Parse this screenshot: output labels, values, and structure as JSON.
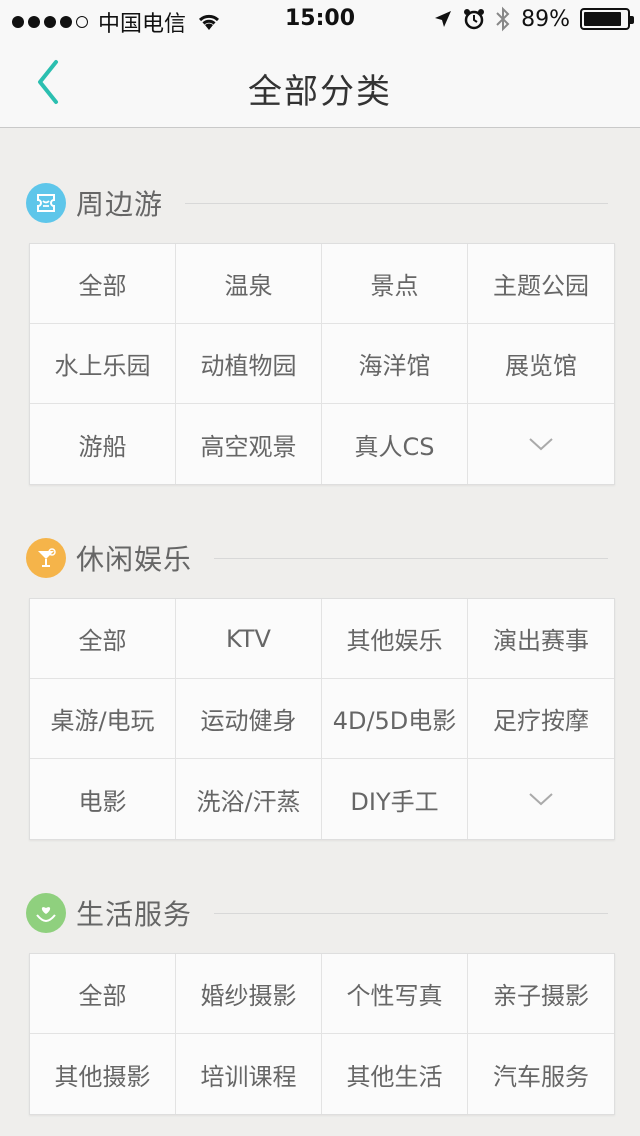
{
  "status_bar": {
    "carrier": "中国电信",
    "time": "15:00",
    "battery_text": "89%",
    "battery_level": 0.89
  },
  "nav": {
    "title": "全部分类",
    "accent_color": "#2bbfb0"
  },
  "sections": [
    {
      "title": "周边游",
      "icon": "ticket-icon",
      "icon_color": "#5ec6ea",
      "items": [
        "全部",
        "温泉",
        "景点",
        "主题公园",
        "水上乐园",
        "动植物园",
        "海洋馆",
        "展览馆",
        "游船",
        "高空观景",
        "真人CS"
      ],
      "has_expand": true
    },
    {
      "title": "休闲娱乐",
      "icon": "cocktail-icon",
      "icon_color": "#f5b44a",
      "items": [
        "全部",
        "KTV",
        "其他娱乐",
        "演出赛事",
        "桌游/电玩",
        "运动健身",
        "4D/5D电影",
        "足疗按摩",
        "电影",
        "洗浴/汗蒸",
        "DIY手工"
      ],
      "has_expand": true
    },
    {
      "title": "生活服务",
      "icon": "heart-hand-icon",
      "icon_color": "#8fd07e",
      "items": [
        "全部",
        "婚纱摄影",
        "个性写真",
        "亲子摄影",
        "其他摄影",
        "培训课程",
        "其他生活",
        "汽车服务"
      ],
      "has_expand": false
    }
  ]
}
